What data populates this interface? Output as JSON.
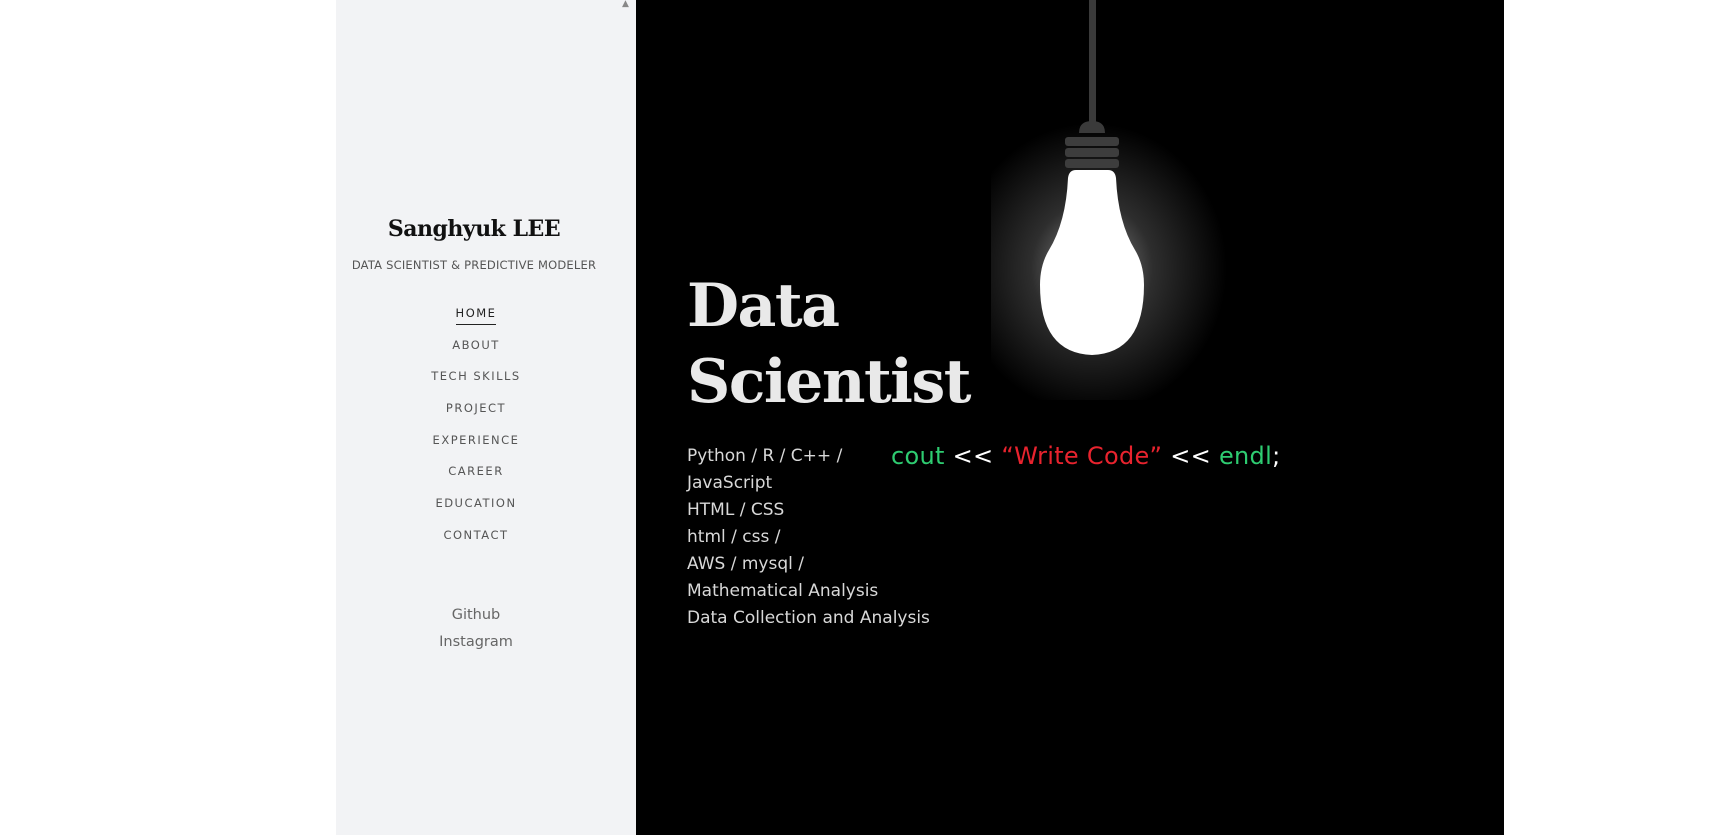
{
  "sidebar": {
    "name": "Sanghyuk LEE",
    "subtitle": "DATA SCIENTIST & PREDICTIVE MODELER",
    "scroll_arrow": "▲",
    "nav": [
      {
        "label": "HOME",
        "active": true
      },
      {
        "label": "ABOUT"
      },
      {
        "label": "TECH SKILLS"
      },
      {
        "label": "PROJECT"
      },
      {
        "label": "EXPERIENCE"
      },
      {
        "label": "CAREER"
      },
      {
        "label": "EDUCATION"
      },
      {
        "label": "CONTACT"
      }
    ],
    "social": [
      {
        "label": "Github"
      },
      {
        "label": "Instagram"
      }
    ]
  },
  "hero": {
    "title_line1": "Data",
    "title_line2": "Scientist",
    "skills": [
      "Python / R / C++ /",
      "JavaScript",
      "HTML / CSS",
      "html / css /",
      "AWS / mysql /",
      "Mathematical Analysis",
      "Data Collection and Analysis"
    ],
    "code": {
      "cout": "cout",
      "op1": " << ",
      "string": "“Write Code”",
      "op2": " << ",
      "endl": "endl",
      "semicolon": ";"
    },
    "bulb_icon": "lightbulb-icon"
  },
  "colors": {
    "sidebar_bg": "#f2f3f5",
    "hero_bg": "#000000",
    "code_keyword": "#2ecc71",
    "code_string": "#e8232e",
    "code_operator": "#ffffff"
  }
}
